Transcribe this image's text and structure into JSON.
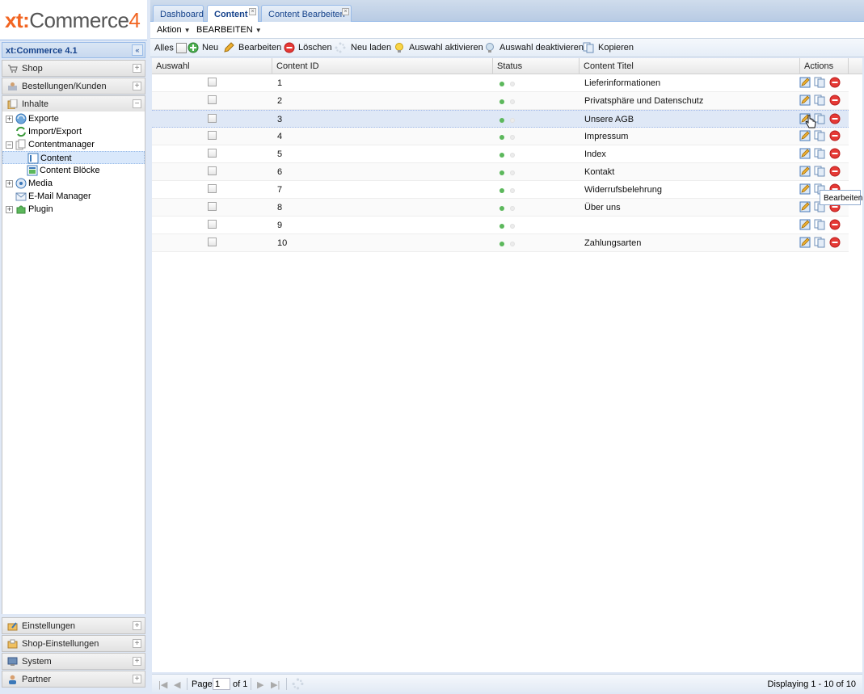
{
  "logo": {
    "xt": "xt:",
    "name": "Commerce",
    "version": "4"
  },
  "sidebar": {
    "header_title": "xt:Commerce 4.1",
    "collapse_symbol": "«",
    "top_sections": [
      {
        "label": "Shop",
        "toggle": "+"
      },
      {
        "label": "Bestellungen/Kunden",
        "toggle": "+"
      },
      {
        "label": "Inhalte",
        "toggle": "−"
      }
    ],
    "tree": [
      {
        "label": "Exporte"
      },
      {
        "label": "Import/Export"
      },
      {
        "label": "Contentmanager"
      },
      {
        "label": "Content"
      },
      {
        "label": "Content Blöcke"
      },
      {
        "label": "Media"
      },
      {
        "label": "E-Mail Manager"
      },
      {
        "label": "Plugin"
      }
    ],
    "bottom_sections": [
      {
        "label": "Einstellungen",
        "toggle": "+"
      },
      {
        "label": "Shop-Einstellungen",
        "toggle": "+"
      },
      {
        "label": "System",
        "toggle": "+"
      },
      {
        "label": "Partner",
        "toggle": "+"
      }
    ]
  },
  "tabs": [
    {
      "label": "Dashboard"
    },
    {
      "label": "Content"
    },
    {
      "label": "Content Bearbeiten"
    }
  ],
  "menubar": {
    "aktion": "Aktion",
    "bearbeiten": "BEARBEITEN"
  },
  "toolbar": {
    "alles": "Alles",
    "neu": "Neu",
    "bearbeiten": "Bearbeiten",
    "loeschen": "Löschen",
    "neu_laden": "Neu laden",
    "auswahl_aktivieren": "Auswahl aktivieren",
    "auswahl_deaktivieren": "Auswahl deaktivieren",
    "kopieren": "Kopieren"
  },
  "grid": {
    "columns": [
      "Auswahl",
      "Content ID",
      "Status",
      "Content Titel",
      "Actions"
    ],
    "rows": [
      {
        "id": "1",
        "title": "Lieferinformationen"
      },
      {
        "id": "2",
        "title": "Privatsphäre und Datenschutz"
      },
      {
        "id": "3",
        "title": "Unsere AGB"
      },
      {
        "id": "4",
        "title": "Impressum"
      },
      {
        "id": "5",
        "title": "Index"
      },
      {
        "id": "6",
        "title": "Kontakt"
      },
      {
        "id": "7",
        "title": "Widerrufsbelehrung"
      },
      {
        "id": "8",
        "title": "Über uns"
      },
      {
        "id": "9",
        "title": ""
      },
      {
        "id": "10",
        "title": "Zahlungsarten"
      }
    ],
    "selected_row": 3
  },
  "tooltip": "Bearbeiten",
  "paging": {
    "page_label": "Page",
    "page_value": "1",
    "of_label": "of 1",
    "displaying": "Displaying 1 - 10 of 10"
  },
  "colors": {
    "accent": "#f26522",
    "header_blue": "#15428b",
    "status_on": "#5cb85c"
  }
}
